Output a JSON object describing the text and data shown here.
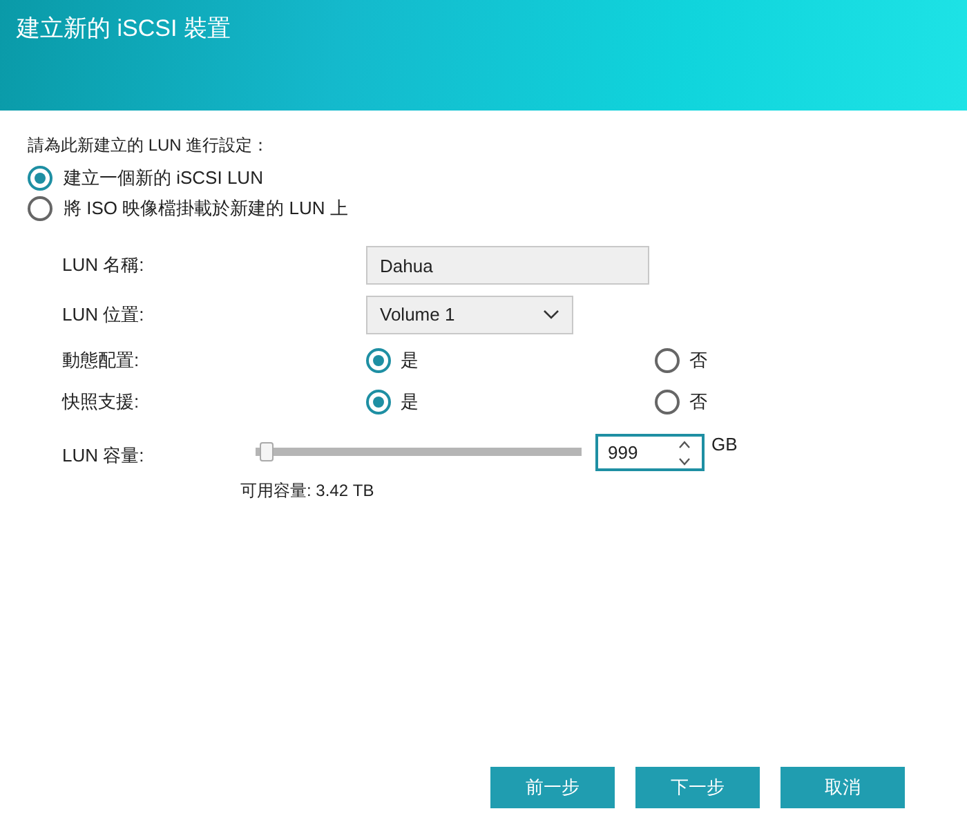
{
  "window": {
    "title": "建立新的 iSCSI 裝置"
  },
  "intro": "請為此新建立的 LUN 進行設定：",
  "modes": [
    {
      "label": "建立一個新的 iSCSI LUN",
      "selected": true
    },
    {
      "label": "將 ISO 映像檔掛載於新建的 LUN 上",
      "selected": false
    }
  ],
  "fields": [
    {
      "kind": "text",
      "label": "LUN 名稱:",
      "value": "Dahua"
    },
    {
      "kind": "select",
      "label": "LUN 位置:",
      "value": "Volume 1"
    },
    {
      "kind": "radio",
      "label": "動態配置:",
      "options": [
        {
          "label": "是",
          "selected": true
        },
        {
          "label": "否",
          "selected": false
        }
      ]
    },
    {
      "kind": "radio",
      "label": "快照支援:",
      "options": [
        {
          "label": "是",
          "selected": true
        },
        {
          "label": "否",
          "selected": false
        }
      ]
    },
    {
      "kind": "size",
      "label": "LUN 容量:",
      "level": 0.02,
      "value": "999",
      "unit": "GB"
    }
  ],
  "available": "可用容量: 3.42 TB",
  "buttons": [
    "前一步",
    "下一步",
    "取消"
  ]
}
